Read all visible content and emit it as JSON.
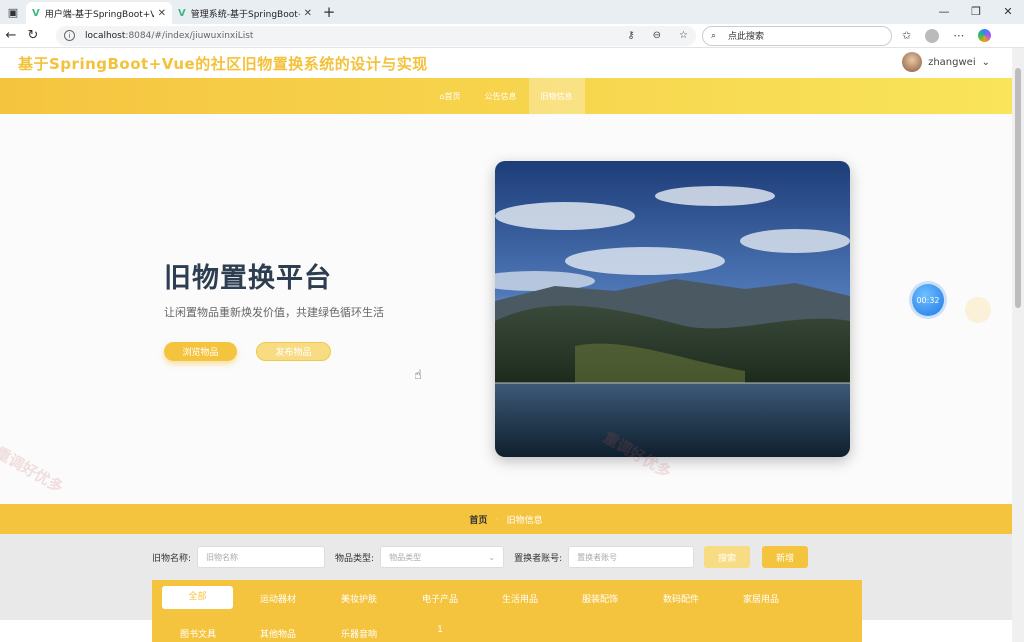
{
  "browser": {
    "tabs": [
      {
        "title": "用户端-基于SpringBoot+Vue的社",
        "active": true
      },
      {
        "title": "管理系统-基于SpringBoot+Vue的",
        "active": false
      }
    ],
    "url_host": "localhost",
    "url_path": ":8084/#/index/jiuwuxinxiList",
    "search_placeholder": "点此搜索"
  },
  "site": {
    "title": "基于SpringBoot+Vue的社区旧物置换系统的设计与实现",
    "username": "zhangwei",
    "menu": [
      "⌂首页",
      "公告信息",
      "旧物信息"
    ]
  },
  "hero": {
    "title": "旧物置换平台",
    "subtitle": "让闲置物品重新焕发价值，共建绿色循环生活",
    "browse_label": "浏览物品",
    "publish_label": "发布物品",
    "timer": "00:32"
  },
  "breadcrumb": {
    "home": "首页",
    "current": "旧物信息"
  },
  "filter": {
    "name_label": "旧物名称:",
    "name_placeholder": "旧物名称",
    "type_label": "物品类型:",
    "type_placeholder": "物品类型",
    "account_label": "置换者账号:",
    "account_placeholder": "置换者账号",
    "search_label": "搜索",
    "add_label": "新增"
  },
  "categories": [
    "全部",
    "运动器材",
    "美妆护肤",
    "电子产品",
    "生活用品",
    "服装配饰",
    "数码配件",
    "家居用品",
    "图书文具",
    "其他物品",
    "乐器音响"
  ],
  "categories_extra": "1",
  "watermark": "重调好优多",
  "colors": {
    "accent": "#f5c43f",
    "title": "#2c3e50"
  }
}
